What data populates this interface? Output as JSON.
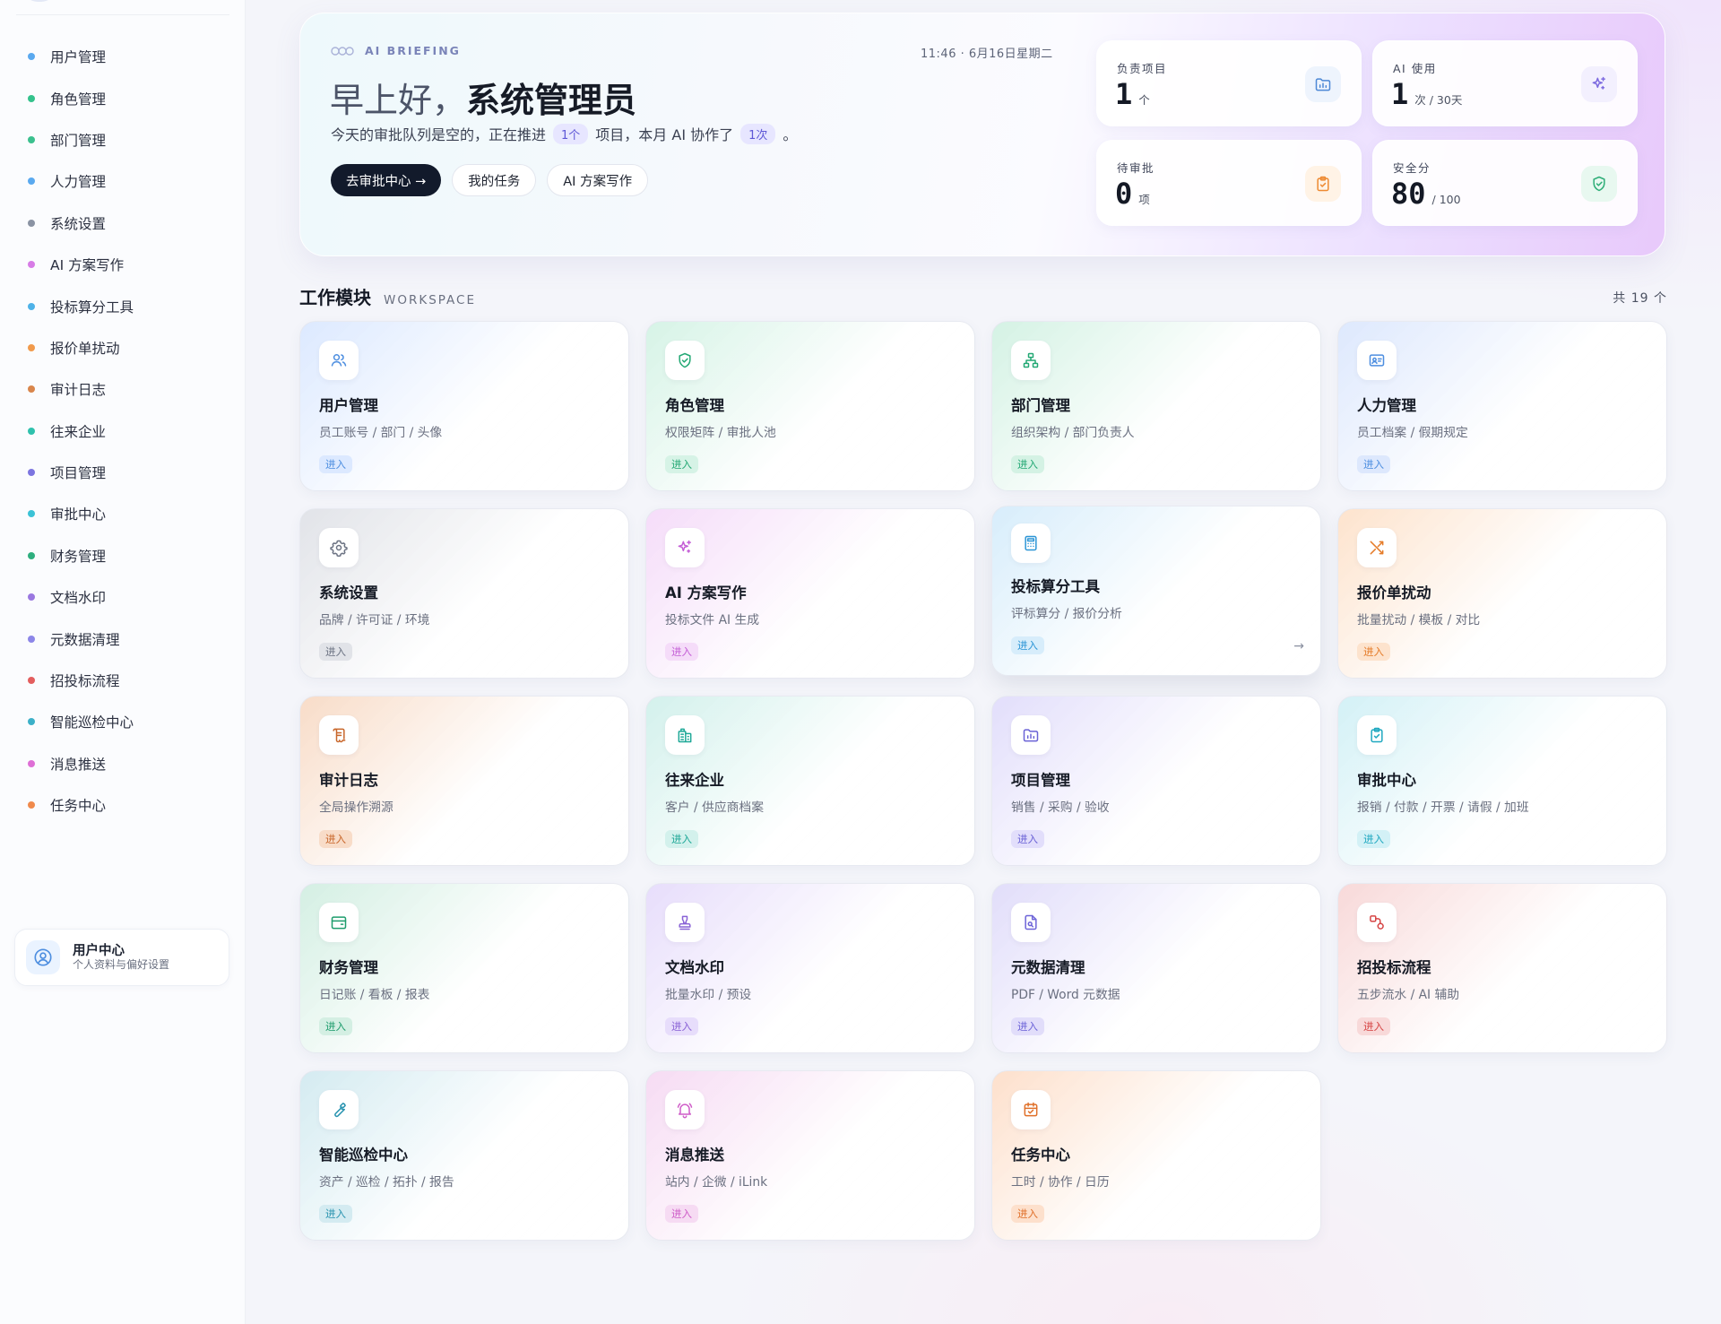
{
  "sidebar": {
    "items": [
      {
        "label": "用户管理",
        "color": "#5aa9ef"
      },
      {
        "label": "角色管理",
        "color": "#34c28c"
      },
      {
        "label": "部门管理",
        "color": "#3bc08e"
      },
      {
        "label": "人力管理",
        "color": "#5aa9ef"
      },
      {
        "label": "系统设置",
        "color": "#8a93a3"
      },
      {
        "label": "AI 方案写作",
        "color": "#d77ce6"
      },
      {
        "label": "投标算分工具",
        "color": "#4eb2e8"
      },
      {
        "label": "报价单扰动",
        "color": "#f19a4c"
      },
      {
        "label": "审计日志",
        "color": "#d9864c"
      },
      {
        "label": "往来企业",
        "color": "#2fc1ad"
      },
      {
        "label": "项目管理",
        "color": "#7c75e0"
      },
      {
        "label": "审批中心",
        "color": "#3bc2d6"
      },
      {
        "label": "财务管理",
        "color": "#2eae7e"
      },
      {
        "label": "文档水印",
        "color": "#9a78e0"
      },
      {
        "label": "元数据清理",
        "color": "#8c86e8"
      },
      {
        "label": "招投标流程",
        "color": "#e35e5e"
      },
      {
        "label": "智能巡检中心",
        "color": "#3cb0c8"
      },
      {
        "label": "消息推送",
        "color": "#de6fd6"
      },
      {
        "label": "任务中心",
        "color": "#f08a4c"
      }
    ],
    "user_center": {
      "title": "用户中心",
      "subtitle": "个人资料与偏好设置",
      "icon": "user-circle-icon"
    }
  },
  "hero": {
    "tag": "AI BRIEFING",
    "time": "11:46 · 6月16日星期二",
    "greeting_prefix": "早上好，",
    "greeting_name": "系统管理员",
    "sub_part1": "今天的审批队列是空的，正在推进",
    "sub_chip1": "1个",
    "sub_part2": "项目，本月 AI 协作了",
    "sub_chip2": "1次",
    "sub_part3": "。",
    "actions": {
      "primary": "去审批中心 →",
      "tasks": "我的任务",
      "ai_writing": "AI 方案写作"
    },
    "stats": [
      {
        "label": "负责项目",
        "value": "1",
        "unit": "个",
        "icon": "folder-chart-icon",
        "color": "#4d88d6",
        "bg": "#eef4fd"
      },
      {
        "label": "AI 使用",
        "value": "1",
        "unit": "次 / 30天",
        "icon": "sparkle-icon",
        "color": "#7d6be0",
        "bg": "#f3f0fe"
      },
      {
        "label": "待审批",
        "value": "0",
        "unit": "项",
        "icon": "clipboard-check-icon",
        "color": "#ee8a32",
        "bg": "#fff3e6"
      },
      {
        "label": "安全分",
        "value": "80",
        "unit": "/ 100",
        "icon": "shield-check-icon",
        "color": "#2fae78",
        "bg": "#e8f8f0"
      }
    ]
  },
  "workspace": {
    "title": "工作模块",
    "subtitle": "WORKSPACE",
    "count": "共 19 个",
    "enter_label": "进入",
    "modules": [
      {
        "title": "用户管理",
        "desc": "员工账号 / 部门 / 头像",
        "icon": "users-icon",
        "color": "#4d8ee0",
        "tint": "#dce9ff"
      },
      {
        "title": "角色管理",
        "desc": "权限矩阵 / 审批人池",
        "icon": "shield-check-icon",
        "color": "#23a874",
        "tint": "#d6f3e6"
      },
      {
        "title": "部门管理",
        "desc": "组织架构 / 部门负责人",
        "icon": "org-chart-icon",
        "color": "#23a874",
        "tint": "#d4f2e4"
      },
      {
        "title": "人力管理",
        "desc": "员工档案 / 假期规定",
        "icon": "id-card-icon",
        "color": "#4d8ee0",
        "tint": "#dde8fd"
      },
      {
        "title": "系统设置",
        "desc": "品牌 / 许可证 / 环境",
        "icon": "gear-icon",
        "color": "#6b7282",
        "tint": "#e1e3e8"
      },
      {
        "title": "AI 方案写作",
        "desc": "投标文件 AI 生成",
        "icon": "sparkle-icon",
        "color": "#c45fd6",
        "tint": "#f5dcf9"
      },
      {
        "title": "投标算分工具",
        "desc": "评标算分 / 报价分析",
        "icon": "calculator-icon",
        "color": "#2c95d6",
        "tint": "#d7edfb"
      },
      {
        "title": "报价单扰动",
        "desc": "批量扰动 / 模板 / 对比",
        "icon": "shuffle-icon",
        "color": "#e57b28",
        "tint": "#fde3cd"
      },
      {
        "title": "审计日志",
        "desc": "全局操作溯源",
        "icon": "scroll-icon",
        "color": "#c8662a",
        "tint": "#f8dcc8"
      },
      {
        "title": "往来企业",
        "desc": "客户 / 供应商档案",
        "icon": "building-icon",
        "color": "#1ea897",
        "tint": "#d3f1ec"
      },
      {
        "title": "项目管理",
        "desc": "销售 / 采购 / 验收",
        "icon": "folder-chart-icon",
        "color": "#6a62d6",
        "tint": "#e2defb"
      },
      {
        "title": "审批中心",
        "desc": "报销 / 付款 / 开票 / 请假 / 加班",
        "icon": "clipboard-check-icon",
        "color": "#1fa8c0",
        "tint": "#d3f1f6"
      },
      {
        "title": "财务管理",
        "desc": "日记账 / 看板 / 报表",
        "icon": "wallet-icon",
        "color": "#1f9d6d",
        "tint": "#d4efe3"
      },
      {
        "title": "文档水印",
        "desc": "批量水印 / 预设",
        "icon": "stamp-icon",
        "color": "#8a63d6",
        "tint": "#e7ddfb"
      },
      {
        "title": "元数据清理",
        "desc": "PDF / Word 元数据",
        "icon": "file-search-icon",
        "color": "#6d64d8",
        "tint": "#e1ddfa"
      },
      {
        "title": "招投标流程",
        "desc": "五步流水 / AI 辅助",
        "icon": "flow-icon",
        "color": "#d64545",
        "tint": "#f8d9d9"
      },
      {
        "title": "智能巡检中心",
        "desc": "资产 / 巡检 / 拓扑 / 报告",
        "icon": "wrench-icon",
        "color": "#2a94b0",
        "tint": "#d4ebf1"
      },
      {
        "title": "消息推送",
        "desc": "站内 / 企微 / iLink",
        "icon": "bell-icon",
        "color": "#cf5cc8",
        "tint": "#f6dbf3"
      },
      {
        "title": "任务中心",
        "desc": "工时 / 协作 / 日历",
        "icon": "calendar-check-icon",
        "color": "#e0702a",
        "tint": "#fde0cc"
      }
    ]
  }
}
